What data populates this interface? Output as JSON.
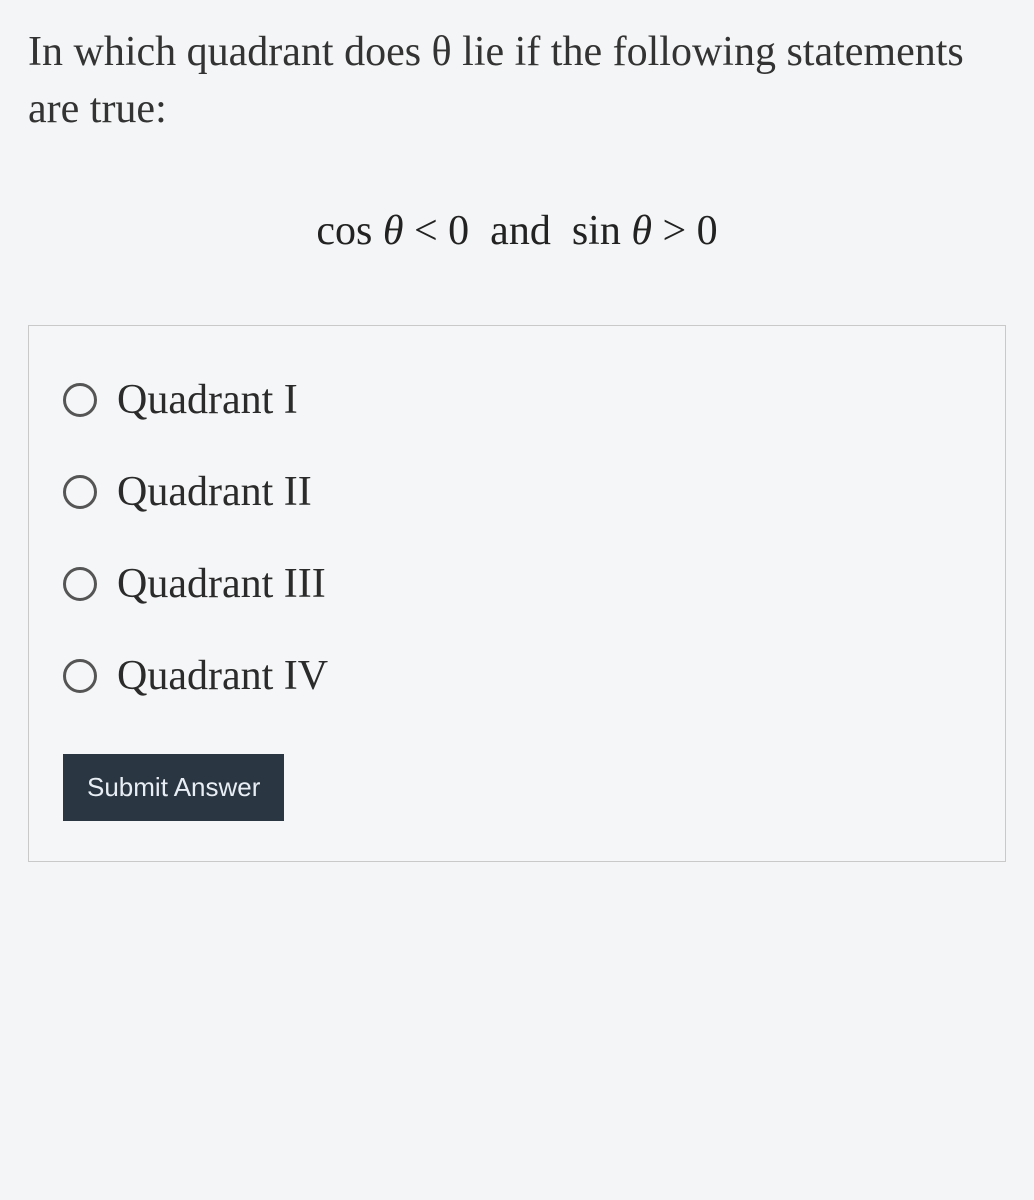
{
  "question": {
    "prompt": "In which quadrant does θ lie if the following statements are true:",
    "equation_text": "cos θ < 0 and  sin θ > 0"
  },
  "options": [
    {
      "label": "Quadrant I"
    },
    {
      "label": "Quadrant II"
    },
    {
      "label": "Quadrant III"
    },
    {
      "label": "Quadrant IV"
    }
  ],
  "submit_label": "Submit Answer"
}
